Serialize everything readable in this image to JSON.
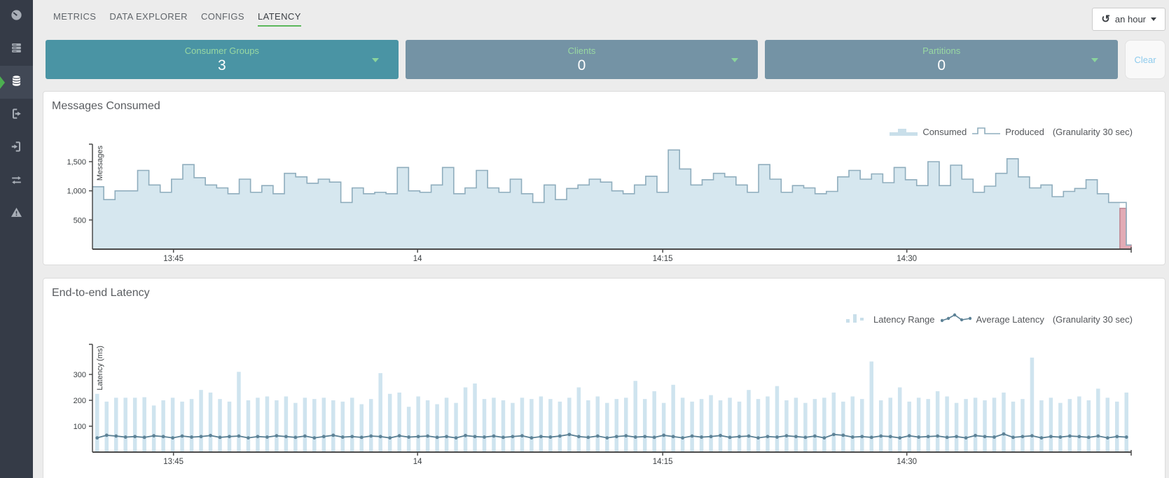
{
  "sidebar": {
    "items": [
      {
        "icon": "gauge-icon",
        "active": false
      },
      {
        "icon": "brokers-icon",
        "active": false
      },
      {
        "icon": "topics-icon",
        "active": true
      },
      {
        "icon": "sign-out-icon",
        "active": false
      },
      {
        "icon": "sign-in-icon",
        "active": false
      },
      {
        "icon": "swap-icon",
        "active": false
      },
      {
        "icon": "alerts-icon",
        "active": false
      }
    ]
  },
  "tabs": [
    {
      "label": "METRICS",
      "active": false
    },
    {
      "label": "DATA EXPLORER",
      "active": false
    },
    {
      "label": "CONFIGS",
      "active": false
    },
    {
      "label": "LATENCY",
      "active": true
    }
  ],
  "time_range": {
    "icon": "history-icon",
    "label": "an hour"
  },
  "filters": [
    {
      "label": "Consumer Groups",
      "value": "3"
    },
    {
      "label": "Clients",
      "value": "0"
    },
    {
      "label": "Partitions",
      "value": "0"
    }
  ],
  "actions": {
    "clear_label": "Clear"
  },
  "colors": {
    "accent_green": "#5cb85c",
    "teal_card": "#4a94a4",
    "slate_card": "#7493a5",
    "card_label_green": "#98d8a2",
    "clear_blue": "#8ecbed",
    "area_fill": "#d6e7ef",
    "area_stroke": "#8fadbd",
    "lag_fill": "#e2abb5",
    "lag_stroke": "#bf8792",
    "latency_bar": "#cfe4ef",
    "avg_line": "#5d8296"
  },
  "chart_data": [
    {
      "type": "area",
      "title": "Messages Consumed",
      "ylabel": "Messages",
      "note": "(Granularity 30 sec)",
      "legend": [
        {
          "name": "Consumed"
        },
        {
          "name": "Produced"
        }
      ],
      "x_ticks": [
        "13:45",
        "14",
        "14:15",
        "14:30"
      ],
      "x_tick_pos": [
        0.078,
        0.313,
        0.549,
        0.784
      ],
      "y_ticks": [
        500,
        1000,
        1500
      ],
      "y_tick_labels": [
        "500",
        "1,000",
        "1,500"
      ],
      "ylim": [
        0,
        1800
      ],
      "series": [
        {
          "name": "Consumed",
          "values": [
            1070,
            850,
            1000,
            1000,
            1350,
            1100,
            975,
            1200,
            1450,
            1225,
            1100,
            1050,
            950,
            1200,
            975,
            1090,
            950,
            1300,
            1240,
            1130,
            1200,
            1150,
            800,
            1050,
            950,
            975,
            950,
            1400,
            1000,
            975,
            1100,
            1400,
            950,
            1050,
            1350,
            1050,
            975,
            1200,
            950,
            800,
            1100,
            850,
            1040,
            1100,
            1200,
            1150,
            1000,
            950,
            1100,
            1250,
            975,
            1700,
            1375,
            1100,
            1190,
            1300,
            1240,
            1100,
            975,
            1450,
            1200,
            975,
            1090,
            1050,
            950,
            990,
            1240,
            1350,
            1200,
            1290,
            1140,
            1400,
            1190,
            1090,
            1500,
            1090,
            1440,
            1200,
            975,
            1080,
            1300,
            1550,
            1240,
            1050,
            1100,
            900,
            990,
            1040,
            1190,
            950,
            800
          ]
        }
      ],
      "end_segment": {
        "produced": 800,
        "consumed_lag": 700,
        "tail": 70
      }
    },
    {
      "type": "bar",
      "title": "End-to-end Latency",
      "ylabel": "Latency (ms)",
      "note": "(Granularity 30 sec)",
      "legend": [
        {
          "name": "Latency Range"
        },
        {
          "name": "Average Latency"
        }
      ],
      "x_ticks": [
        "13:45",
        "14",
        "14:15",
        "14:30"
      ],
      "x_tick_pos": [
        0.078,
        0.313,
        0.549,
        0.784
      ],
      "y_ticks": [
        100,
        200,
        300
      ],
      "y_tick_labels": [
        "100",
        "200",
        "300"
      ],
      "ylim": [
        0,
        400
      ],
      "series": [
        {
          "name": "Latency Range",
          "values": [
            225,
            195,
            210,
            210,
            210,
            212,
            180,
            200,
            210,
            195,
            205,
            240,
            230,
            205,
            195,
            310,
            200,
            210,
            215,
            200,
            215,
            190,
            210,
            205,
            210,
            200,
            195,
            210,
            185,
            205,
            305,
            225,
            230,
            175,
            215,
            200,
            185,
            210,
            190,
            250,
            265,
            205,
            210,
            200,
            190,
            210,
            205,
            215,
            205,
            195,
            210,
            250,
            200,
            215,
            190,
            205,
            210,
            275,
            205,
            235,
            190,
            260,
            210,
            195,
            205,
            220,
            200,
            210,
            195,
            240,
            205,
            215,
            255,
            200,
            210,
            190,
            205,
            210,
            230,
            195,
            215,
            205,
            350,
            200,
            210,
            250,
            195,
            210,
            205,
            235,
            215,
            190,
            205,
            210,
            200,
            210,
            230,
            195,
            205,
            365,
            200,
            210,
            190,
            205,
            215,
            200,
            245,
            210,
            195,
            230
          ]
        },
        {
          "name": "Average Latency",
          "values": [
            55,
            65,
            62,
            58,
            60,
            57,
            63,
            60,
            55,
            62,
            58,
            60,
            64,
            57,
            60,
            62,
            55,
            60,
            58,
            63,
            60,
            57,
            62,
            55,
            60,
            65,
            58,
            60,
            57,
            62,
            60,
            55,
            63,
            58,
            60,
            62,
            57,
            60,
            55,
            64,
            60,
            58,
            62,
            57,
            60,
            63,
            55,
            60,
            58,
            62,
            68,
            60,
            57,
            62,
            55,
            60,
            63,
            58,
            60,
            57,
            65,
            60,
            55,
            62,
            58,
            60,
            64,
            57,
            60,
            62,
            55,
            60,
            58,
            63,
            60,
            57,
            62,
            55,
            68,
            65,
            58,
            60,
            57,
            62,
            60,
            55,
            63,
            58,
            60,
            62,
            57,
            60,
            55,
            64,
            60,
            58,
            70,
            57,
            60,
            63,
            55,
            60,
            58,
            62,
            60,
            57,
            62,
            55,
            60,
            58
          ]
        }
      ]
    }
  ]
}
